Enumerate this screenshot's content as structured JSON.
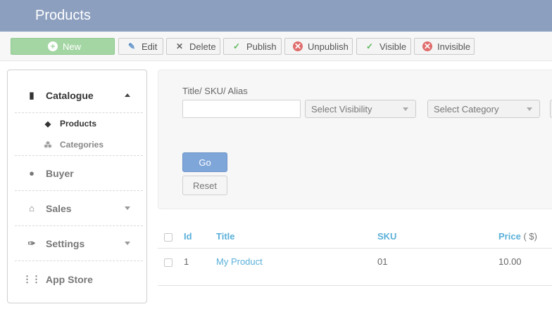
{
  "header": {
    "title": "Products"
  },
  "toolbar": {
    "new_label": "New",
    "edit_label": "Edit",
    "delete_label": "Delete",
    "publish_label": "Publish",
    "unpublish_label": "Unpublish",
    "visible_label": "Visible",
    "invisible_label": "Invisible"
  },
  "sidebar": {
    "catalogue": "Catalogue",
    "products": "Products",
    "categories": "Categories",
    "buyer": "Buyer",
    "sales": "Sales",
    "settings": "Settings",
    "app_store": "App Store"
  },
  "filter": {
    "label": "Title/ SKU/ Alias",
    "search_value": "",
    "visibility": "Select Visibility",
    "category": "Select Category",
    "go": "Go",
    "reset": "Reset"
  },
  "table": {
    "headers": {
      "id": "Id",
      "title": "Title",
      "sku": "SKU",
      "price": "Price",
      "price_unit": "( $)"
    },
    "rows": [
      {
        "id": "1",
        "title": "My Product",
        "sku": "01",
        "price": "10.00"
      }
    ]
  },
  "colors": {
    "header": "#8c9fbf",
    "new_button": "#a4d6a4",
    "go_button": "#7fa6d9",
    "link": "#5ab0d9"
  }
}
